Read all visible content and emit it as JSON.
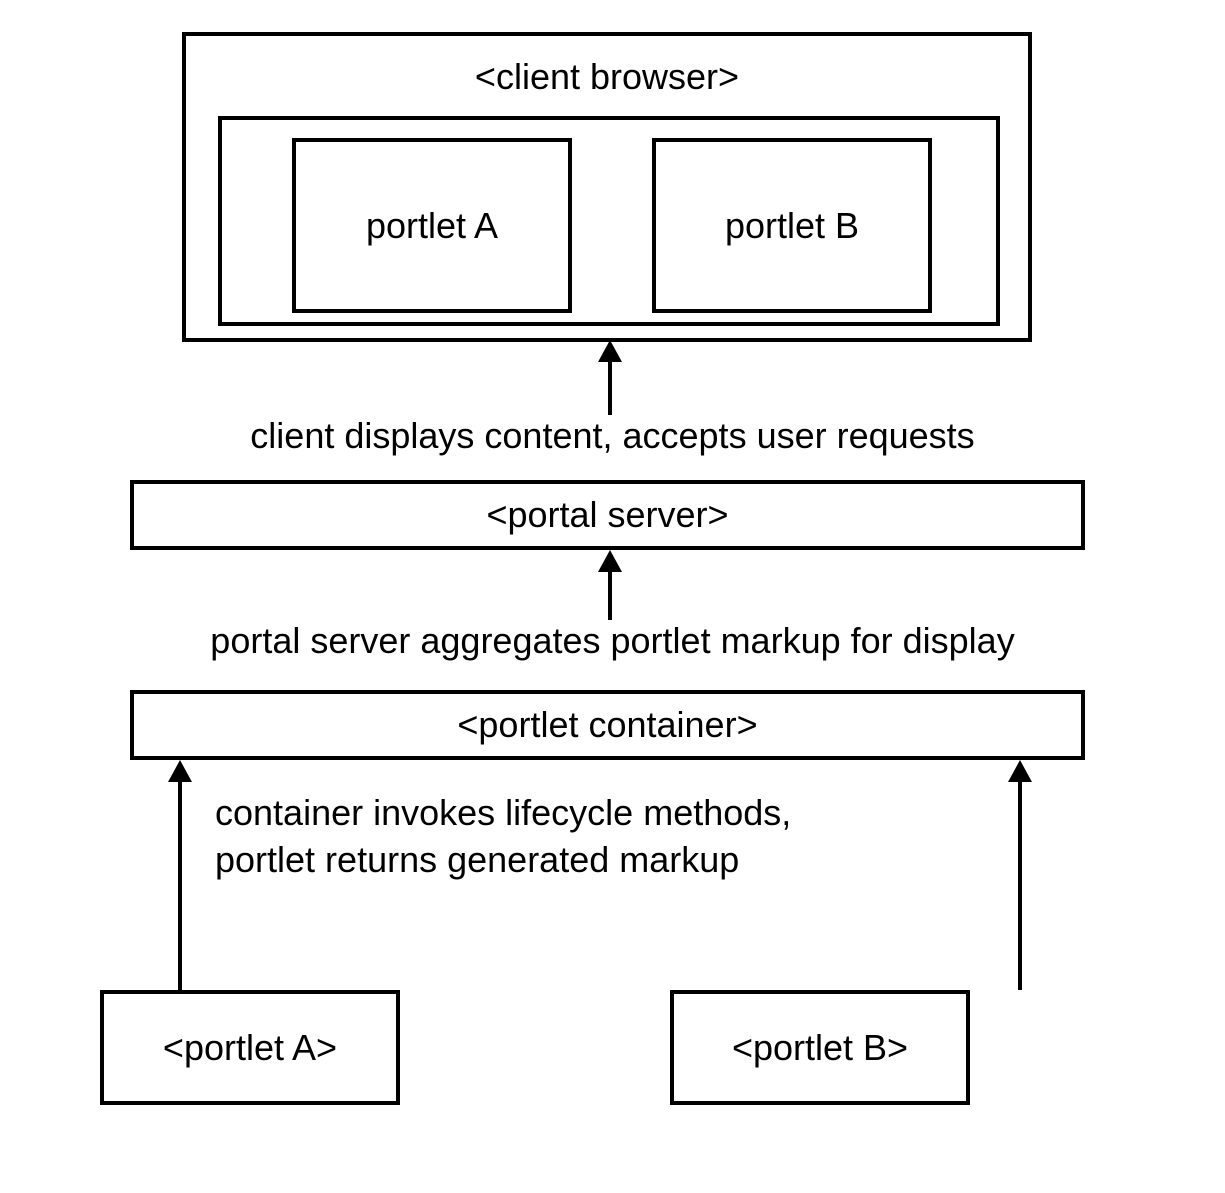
{
  "diagram": {
    "browser": {
      "title": "<client browser>",
      "portlets": {
        "a": "portlet A",
        "b": "portlet  B"
      }
    },
    "flow": {
      "label1": "client displays content, accepts user requests",
      "label2": "portal server aggregates portlet markup for display",
      "label3_line1": "container invokes lifecycle methods,",
      "label3_line2": "portlet returns generated markup"
    },
    "server": "<portal server>",
    "container": "<portlet container>",
    "portlets": {
      "a": "<portlet A>",
      "b": "<portlet B>"
    }
  }
}
